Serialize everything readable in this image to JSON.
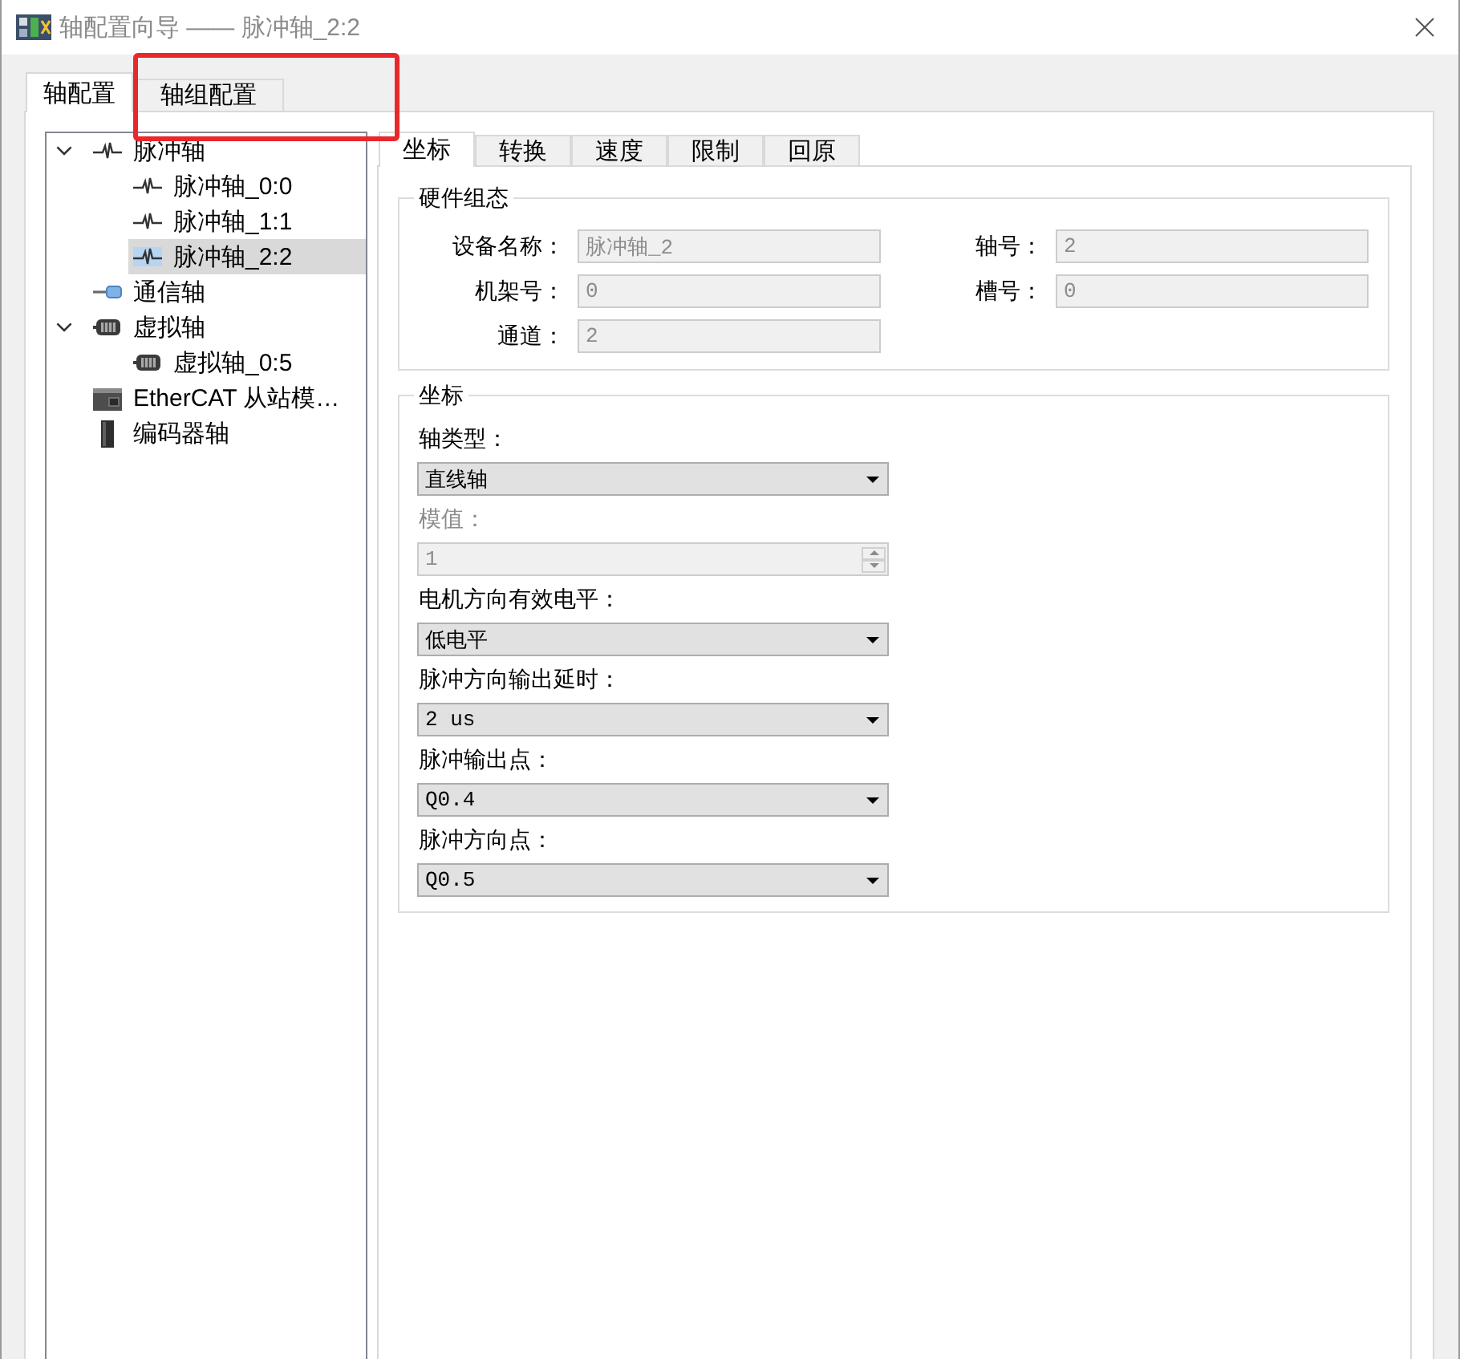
{
  "window": {
    "title": "轴配置向导 —— 脉冲轴_2:2"
  },
  "tabs": [
    {
      "label": "轴配置",
      "selected": true
    },
    {
      "label": "轴组配置",
      "selected": false
    }
  ],
  "tree": {
    "items": [
      {
        "label": "脉冲轴",
        "kind": "pulse",
        "expanded": true,
        "selected": false,
        "children": [
          {
            "label": "脉冲轴_0:0",
            "kind": "pulse",
            "selected": false
          },
          {
            "label": "脉冲轴_1:1",
            "kind": "pulse",
            "selected": false
          },
          {
            "label": "脉冲轴_2:2",
            "kind": "pulse",
            "selected": true
          }
        ]
      },
      {
        "label": "通信轴",
        "kind": "comm",
        "selected": false
      },
      {
        "label": "虚拟轴",
        "kind": "virtual",
        "expanded": true,
        "selected": false,
        "children": [
          {
            "label": "虚拟轴_0:5",
            "kind": "virtual",
            "selected": false
          }
        ]
      },
      {
        "label": "EtherCAT 从站模…",
        "kind": "ethercat",
        "selected": false
      },
      {
        "label": "编码器轴",
        "kind": "encoder",
        "selected": false
      }
    ]
  },
  "settings_tabs": [
    {
      "label": "坐标",
      "selected": true
    },
    {
      "label": "转换",
      "selected": false
    },
    {
      "label": "速度",
      "selected": false
    },
    {
      "label": "限制",
      "selected": false
    },
    {
      "label": "回原",
      "selected": false
    }
  ],
  "hardware_group": {
    "title": "硬件组态",
    "fields": [
      {
        "label": "设备名称：",
        "value": "脉冲轴_2",
        "disabled": true
      },
      {
        "label": "轴号：",
        "value": "2",
        "disabled": true
      },
      {
        "label": "机架号：",
        "value": "0",
        "disabled": true
      },
      {
        "label": "槽号：",
        "value": "0",
        "disabled": true
      },
      {
        "label": "通道：",
        "value": "2",
        "disabled": true
      }
    ]
  },
  "coordinate_group": {
    "title": "坐标",
    "fields": [
      {
        "label": "轴类型：",
        "kind": "dropdown",
        "value": "直线轴",
        "disabled": false
      },
      {
        "label": "模值：",
        "kind": "spinbox",
        "value": "1",
        "disabled": true
      },
      {
        "label": "电机方向有效电平：",
        "kind": "dropdown",
        "value": "低电平",
        "disabled": false
      },
      {
        "label": "脉冲方向输出延时：",
        "kind": "dropdown",
        "value": "2 us",
        "disabled": false
      },
      {
        "label": "脉冲输出点：",
        "kind": "dropdown",
        "value": "Q0.4",
        "disabled": false
      },
      {
        "label": "脉冲方向点：",
        "kind": "dropdown",
        "value": "Q0.5",
        "disabled": false
      }
    ]
  },
  "annotations": [
    {
      "kind": "rectangle"
    }
  ]
}
